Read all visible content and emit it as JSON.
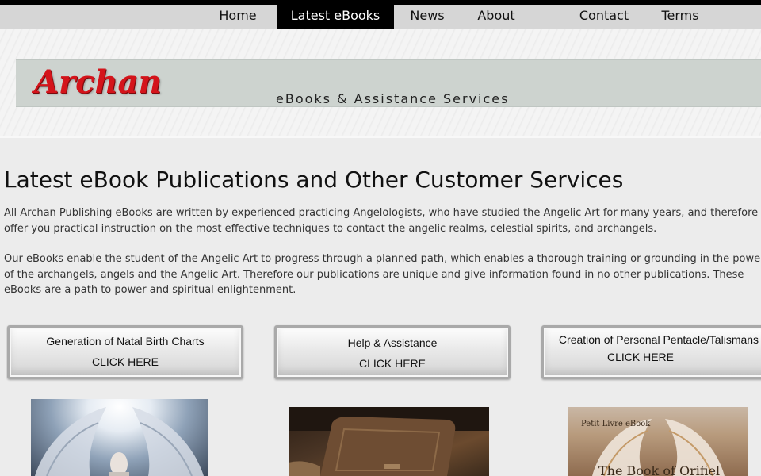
{
  "nav": {
    "items": [
      {
        "label": "Home"
      },
      {
        "label": "Latest eBooks"
      },
      {
        "label": "News"
      },
      {
        "label": "About"
      },
      {
        "label": "Contact"
      },
      {
        "label": "Terms"
      }
    ],
    "active": "Latest eBooks"
  },
  "header": {
    "logo_text": "Archan",
    "tagline": "eBooks & Assistance Services"
  },
  "main": {
    "title": "Latest eBook Publications and Other Customer Services",
    "paragraph1": "All Archan Publishing eBooks are written by experienced practicing Angelologists, who have studied the Angelic Art for many years, and therefore offer you practical instruction on the most effective techniques to contact the angelic realms, celestial spirits, and archangels.",
    "paragraph2": "Our eBooks enable the student of the Angelic Art to progress through a planned path, which enables a thorough training or grounding in the power of the archangels, angels and the Angelic Art. Therefore our publications are unique and give information found in no other publications. These eBooks are a path to power and spiritual enlightenment."
  },
  "services": [
    {
      "title": "Generation of Natal Birth Charts",
      "cta": "CLICK HERE"
    },
    {
      "title": "Help & Assistance",
      "cta": "CLICK HERE"
    },
    {
      "title": "Creation of Personal Pentacle/Talismans",
      "cta": "CLICK HERE"
    }
  ],
  "images": [
    {
      "icon": "angel-wings-image"
    },
    {
      "icon": "old-book-image"
    },
    {
      "icon": "book-cover-image",
      "small_text": "Petit Livre eBook",
      "title_text": "The Book of Orifiel"
    }
  ],
  "colors": {
    "nav_active_bg": "#000000",
    "logo_red": "#d4141b",
    "banner_bg": "#cdd3cf",
    "page_bg": "#ececec"
  }
}
